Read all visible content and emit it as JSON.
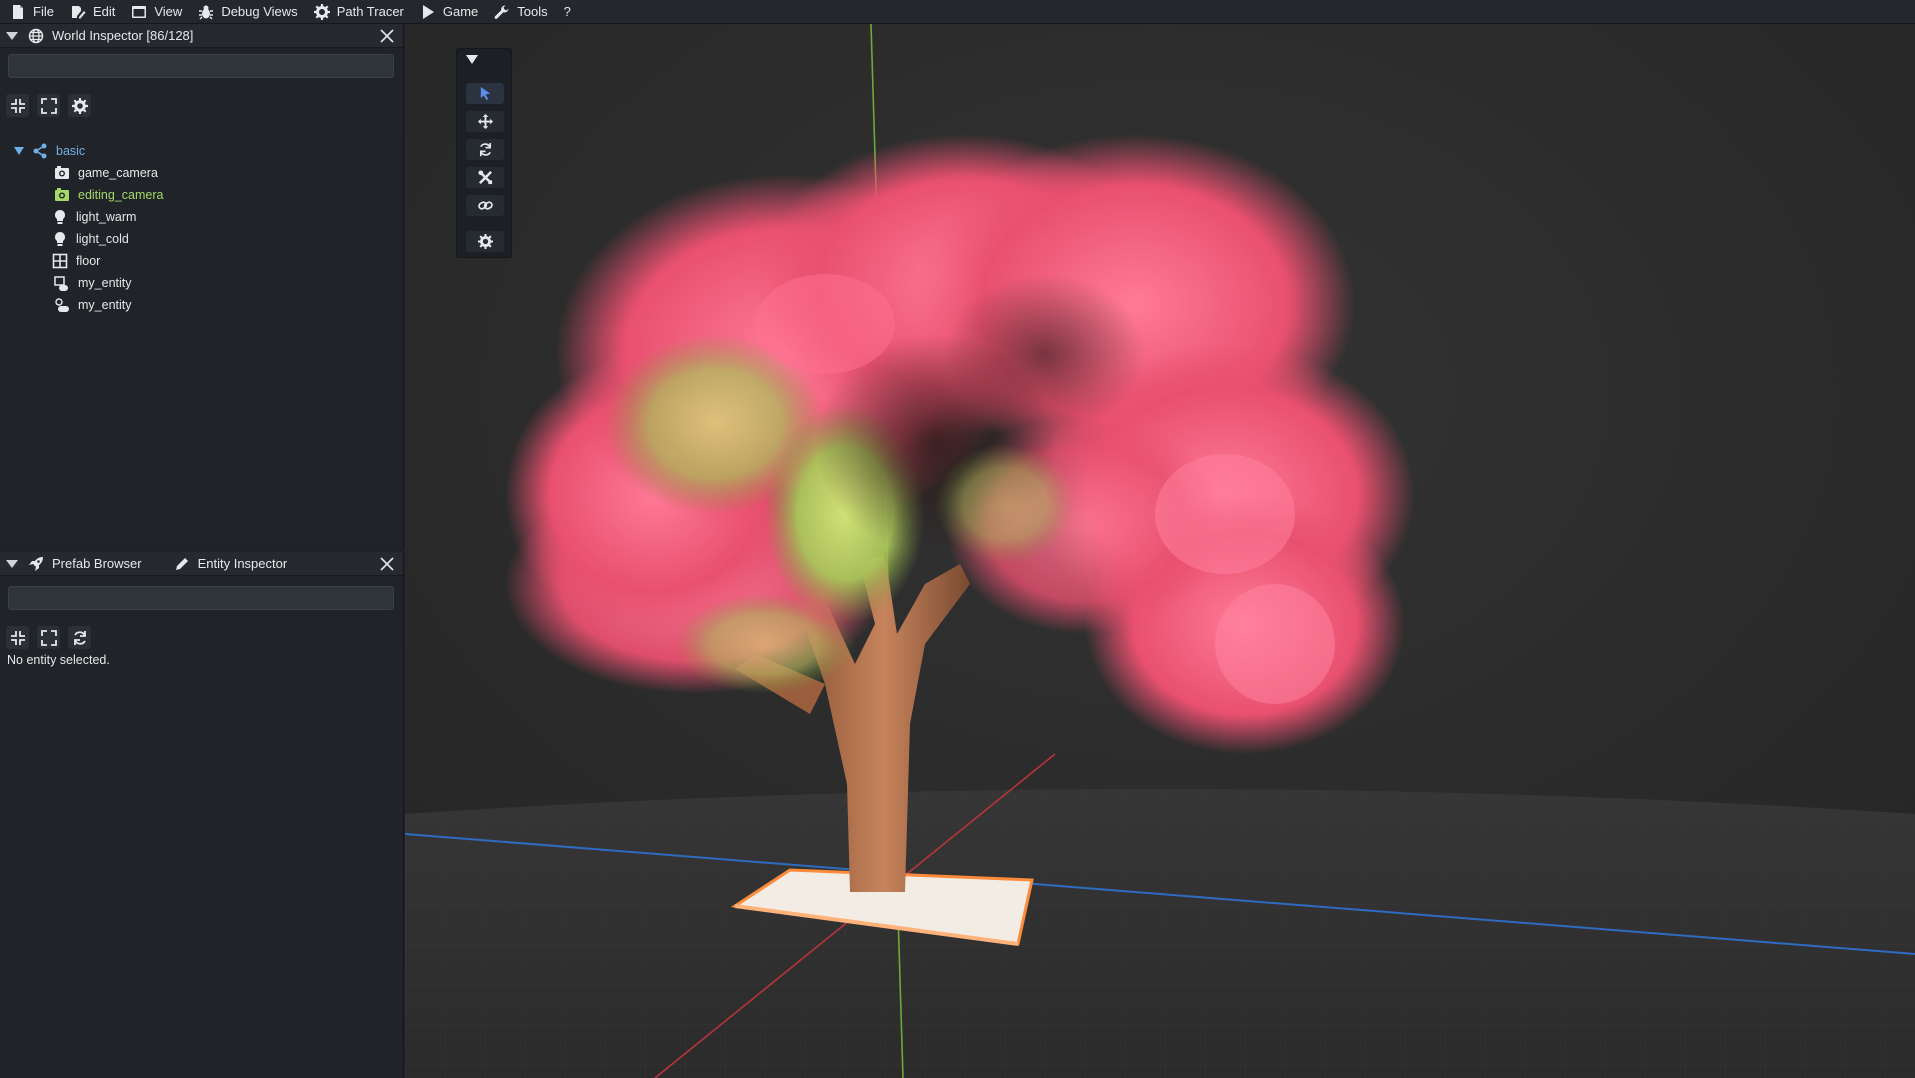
{
  "menu": {
    "items": [
      {
        "label": "File",
        "icon": "file-icon"
      },
      {
        "label": "Edit",
        "icon": "edit-icon"
      },
      {
        "label": "View",
        "icon": "window-icon"
      },
      {
        "label": "Debug Views",
        "icon": "bug-icon"
      },
      {
        "label": "Path Tracer",
        "icon": "gear-icon"
      },
      {
        "label": "Game",
        "icon": "play-icon"
      },
      {
        "label": "Tools",
        "icon": "wrench-icon"
      },
      {
        "label": "?",
        "icon": ""
      }
    ]
  },
  "world_inspector": {
    "title": "World Inspector [86/128]",
    "search_value": "",
    "tree": {
      "root": {
        "label": "basic",
        "icon": "share-nodes-icon"
      },
      "children": [
        {
          "label": "game_camera",
          "icon": "camera-icon",
          "selected": false
        },
        {
          "label": "editing_camera",
          "icon": "camera-icon",
          "selected": true
        },
        {
          "label": "light_warm",
          "icon": "lightbulb-icon",
          "selected": false
        },
        {
          "label": "light_cold",
          "icon": "lightbulb-icon",
          "selected": false
        },
        {
          "label": "floor",
          "icon": "grid-icon",
          "selected": false
        },
        {
          "label": "my_entity",
          "icon": "cloud-icon",
          "selected": false
        },
        {
          "label": "my_entity",
          "icon": "cloud-sun-icon",
          "selected": false
        }
      ]
    }
  },
  "bottom_panel": {
    "tabs": [
      {
        "label": "Prefab Browser",
        "icon": "rocket-icon"
      },
      {
        "label": "Entity Inspector",
        "icon": "pencil-icon"
      }
    ],
    "search_value": "",
    "empty_message": "No entity selected."
  },
  "colors": {
    "accent_blue": "#6fb1e7",
    "selected_green": "#a5d86a",
    "gizmo_active": "#5b8fe8"
  }
}
